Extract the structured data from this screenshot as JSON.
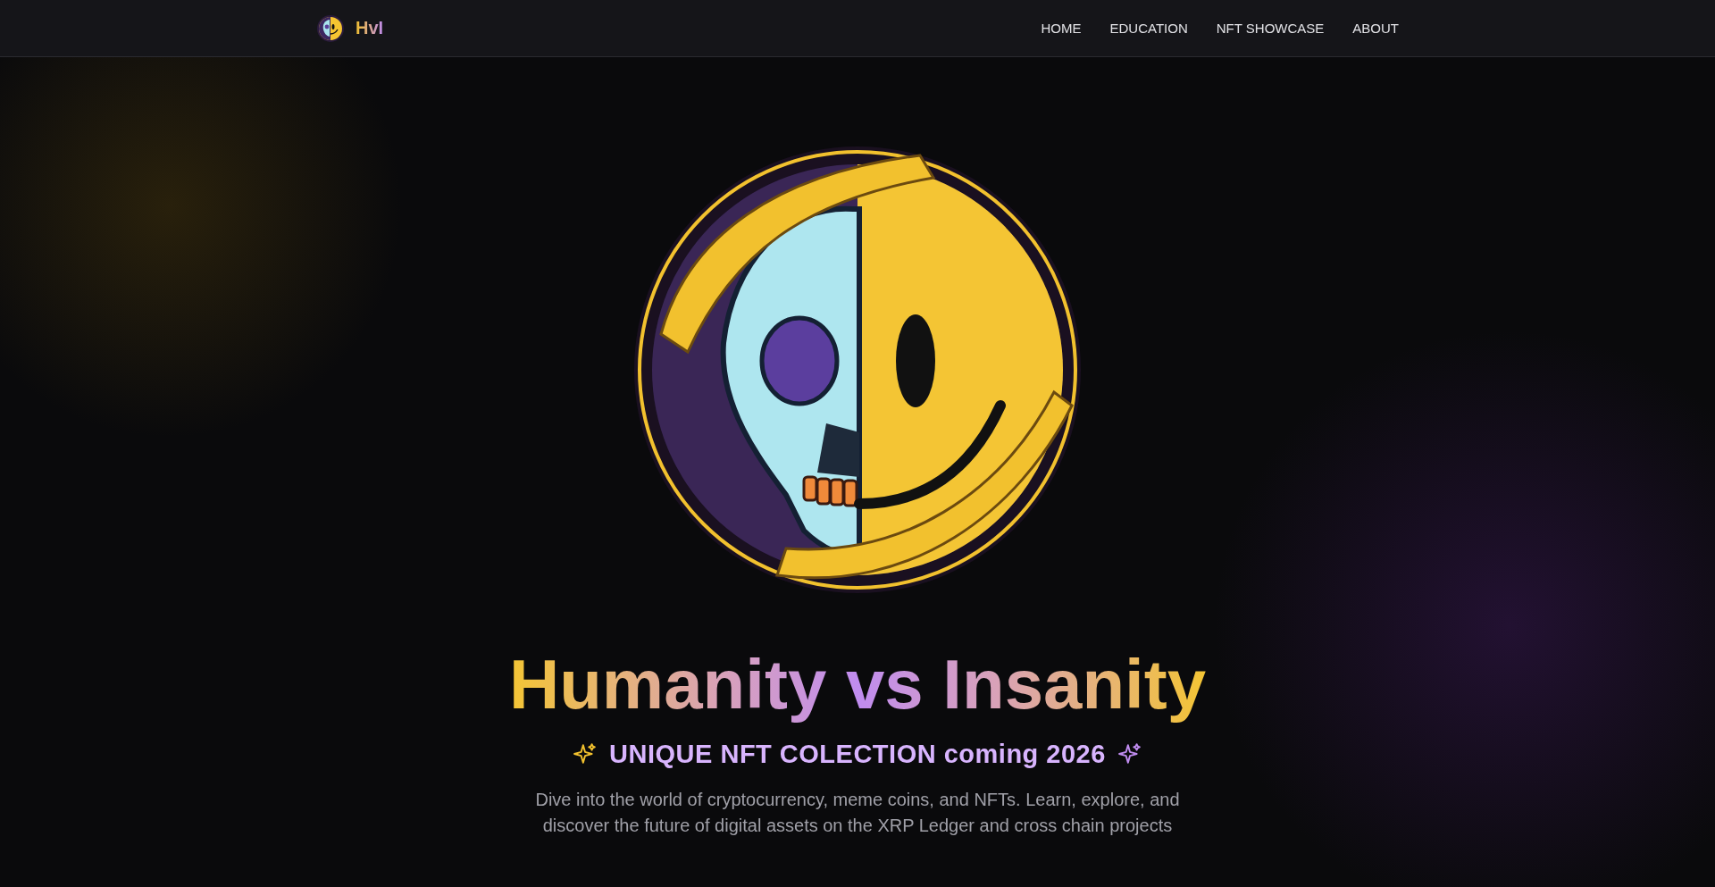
{
  "header": {
    "logo_text": "HvI",
    "nav": [
      {
        "label": "HOME"
      },
      {
        "label": "EDUCATION"
      },
      {
        "label": "NFT SHOWCASE"
      },
      {
        "label": "ABOUT"
      }
    ]
  },
  "hero": {
    "title": "Humanity vs Insanity",
    "tagline": "UNIQUE NFT COLECTION coming 2026",
    "description": "Dive into the world of cryptocurrency, meme coins, and NFTs. Learn, explore, and discover the future of digital assets on the XRP Ledger and cross chain projects"
  }
}
